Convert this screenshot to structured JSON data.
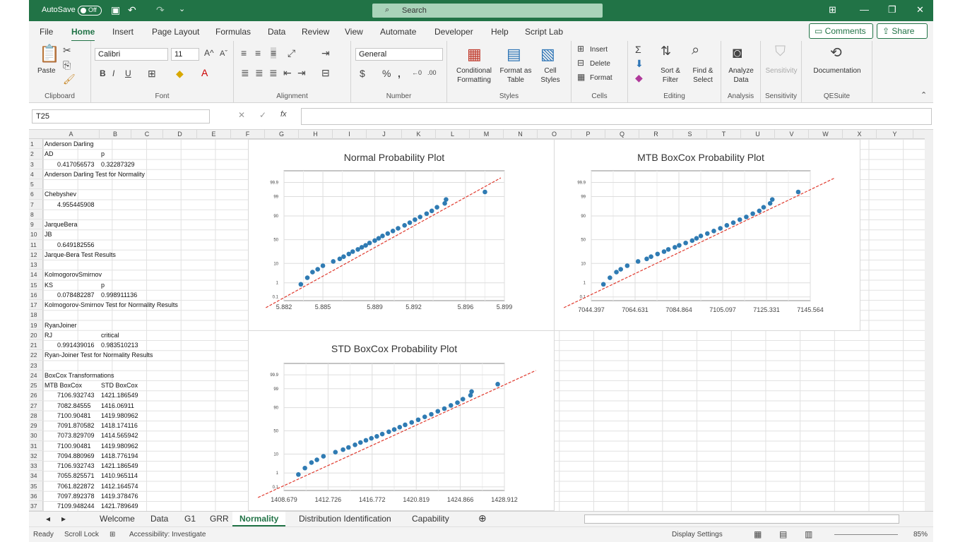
{
  "titlebar": {
    "autosave_label": "AutoSave",
    "autosave_state": "Off",
    "search_placeholder": "Search"
  },
  "menu": {
    "tabs": [
      "File",
      "Home",
      "Insert",
      "Page Layout",
      "Formulas",
      "Data",
      "Review",
      "View",
      "Automate",
      "Developer",
      "Help",
      "Script Lab"
    ],
    "active": "Home",
    "comments": "Comments",
    "share": "Share"
  },
  "ribbon": {
    "clipboard": {
      "paste": "Paste",
      "label": "Clipboard"
    },
    "font": {
      "name": "Calibri",
      "size": "11",
      "label": "Font"
    },
    "alignment": {
      "label": "Alignment"
    },
    "number": {
      "format": "General",
      "label": "Number"
    },
    "styles": {
      "conditional": "Conditional Formatting",
      "format_table": "Format as Table",
      "cell_styles": "Cell Styles",
      "label": "Styles"
    },
    "cells": {
      "insert": "Insert",
      "delete": "Delete",
      "format": "Format",
      "label": "Cells"
    },
    "editing": {
      "sort": "Sort & Filter",
      "find": "Find & Select",
      "label": "Editing"
    },
    "analysis": {
      "analyze": "Analyze Data",
      "label": "Analysis"
    },
    "sensitivity": {
      "btn": "Sensitivity",
      "label": "Sensitivity"
    },
    "qesuite": {
      "doc": "Documentation",
      "label": "QESuite"
    }
  },
  "formula_bar": {
    "name_box": "T25",
    "fx": "fx",
    "value": ""
  },
  "columns": [
    "A",
    "B",
    "C",
    "D",
    "E",
    "F",
    "G",
    "H",
    "I",
    "J",
    "K",
    "L",
    "M",
    "N",
    "O",
    "P",
    "Q",
    "R",
    "S",
    "T",
    "U",
    "V",
    "W",
    "X",
    "Y"
  ],
  "rows": [
    "1",
    "2",
    "3",
    "4",
    "5",
    "6",
    "7",
    "8",
    "9",
    "10",
    "11",
    "12",
    "13",
    "14",
    "15",
    "16",
    "17",
    "18",
    "19",
    "20",
    "21",
    "22",
    "23",
    "24",
    "25",
    "26",
    "27",
    "28",
    "29",
    "30",
    "31",
    "32",
    "33",
    "34",
    "35",
    "36",
    "37"
  ],
  "cells": {
    "r1a": "Anderson Darling",
    "r2a": "AD",
    "r2b": "p",
    "r3a": "0.417056573",
    "r3b": "0.32287329",
    "r4a": "Anderson Darling Test for Normality",
    "r6a": "Chebyshev",
    "r7a": "4.955445908",
    "r9a": "JarqueBera",
    "r10a": "JB",
    "r11a": "0.649182556",
    "r12a": "Jarque-Bera Test Results",
    "r14a": "KolmogorovSmirnov",
    "r15a": "KS",
    "r15b": "p",
    "r16a": "0.078482287",
    "r16b": "0.998911136",
    "r17a": "Kolmogorov-Smirnov Test for Normality Results",
    "r19a": "RyanJoiner",
    "r20a": "RJ",
    "r20b": "critical",
    "r21a": "0.991439016",
    "r21b": "0.983510213",
    "r22a": "Ryan-Joiner Test for Normality Results",
    "r24a": "BoxCox Transformations",
    "r25a": "MTB BoxCox",
    "r25b": "STD BoxCox",
    "r26a": "7106.932743",
    "r26b": "1421.186549",
    "r27a": "7082.84555",
    "r27b": "1416.06911",
    "r28a": "7100.90481",
    "r28b": "1419.980962",
    "r29a": "7091.870582",
    "r29b": "1418.174116",
    "r30a": "7073.829709",
    "r30b": "1414.565942",
    "r31a": "7100.90481",
    "r31b": "1419.980962",
    "r32a": "7094.880969",
    "r32b": "1418.776194",
    "r33a": "7106.932743",
    "r33b": "1421.186549",
    "r34a": "7055.825571",
    "r34b": "1410.965114",
    "r35a": "7061.822872",
    "r35b": "1412.164574",
    "r36a": "7097.892378",
    "r36b": "1419.378476",
    "r37a": "7109.948244",
    "r37b": "1421.789649"
  },
  "chart_data": [
    {
      "type": "scatter",
      "title": "Normal Probability Plot",
      "y_ticks": [
        "99.9",
        "99",
        "90",
        "50",
        "10",
        "1",
        "0.1"
      ],
      "x_ticks": [
        "5.882",
        "5.885",
        "5.889",
        "5.892",
        "5.896",
        "5.899"
      ],
      "fit_line": "red dashed",
      "points": [
        [
          5.8833,
          0.8
        ],
        [
          5.8838,
          2
        ],
        [
          5.8842,
          4
        ],
        [
          5.8846,
          5.5
        ],
        [
          5.885,
          8
        ],
        [
          5.8858,
          12
        ],
        [
          5.8863,
          15
        ],
        [
          5.8866,
          18
        ],
        [
          5.887,
          22
        ],
        [
          5.8873,
          26
        ],
        [
          5.8877,
          30
        ],
        [
          5.888,
          34
        ],
        [
          5.8883,
          38
        ],
        [
          5.8886,
          43
        ],
        [
          5.889,
          48
        ],
        [
          5.8893,
          53
        ],
        [
          5.8896,
          58
        ],
        [
          5.89,
          63
        ],
        [
          5.8904,
          68
        ],
        [
          5.8908,
          73
        ],
        [
          5.8913,
          78
        ],
        [
          5.8917,
          82
        ],
        [
          5.8921,
          86
        ],
        [
          5.8925,
          89
        ],
        [
          5.893,
          92
        ],
        [
          5.8934,
          94
        ],
        [
          5.8938,
          96
        ],
        [
          5.8944,
          97.5
        ],
        [
          5.8945,
          98.5
        ],
        [
          5.8975,
          99.5
        ]
      ]
    },
    {
      "type": "scatter",
      "title": "MTB BoxCox Probability Plot",
      "y_ticks": [
        "99.9",
        "99",
        "90",
        "50",
        "10",
        "1",
        "0.1"
      ],
      "x_ticks": [
        "7044.397",
        "7064.631",
        "7084.864",
        "7105.097",
        "7125.331",
        "7145.564"
      ],
      "fit_line": "red dashed",
      "points": [
        [
          7050,
          0.8
        ],
        [
          7053,
          2
        ],
        [
          7056,
          4
        ],
        [
          7058,
          5.5
        ],
        [
          7061,
          8
        ],
        [
          7066,
          12
        ],
        [
          7070,
          15
        ],
        [
          7072,
          18
        ],
        [
          7075,
          22
        ],
        [
          7078,
          26
        ],
        [
          7080,
          30
        ],
        [
          7083,
          34
        ],
        [
          7085,
          38
        ],
        [
          7088,
          43
        ],
        [
          7091,
          48
        ],
        [
          7093,
          53
        ],
        [
          7095,
          58
        ],
        [
          7098,
          63
        ],
        [
          7101,
          68
        ],
        [
          7104,
          73
        ],
        [
          7107,
          78
        ],
        [
          7110,
          82
        ],
        [
          7113,
          86
        ],
        [
          7116,
          89
        ],
        [
          7119,
          92
        ],
        [
          7122,
          94
        ],
        [
          7124,
          96
        ],
        [
          7127,
          97.5
        ],
        [
          7128,
          98.5
        ],
        [
          7140,
          99.5
        ]
      ]
    },
    {
      "type": "scatter",
      "title": "STD BoxCox Probability Plot",
      "y_ticks": [
        "99.9",
        "99",
        "90",
        "50",
        "10",
        "1",
        "0.1"
      ],
      "x_ticks": [
        "1408.679",
        "1412.726",
        "1416.772",
        "1420.819",
        "1424.866",
        "1428.912"
      ],
      "fit_line": "red dashed",
      "points": [
        [
          1410.0,
          0.8
        ],
        [
          1410.6,
          2
        ],
        [
          1411.2,
          4
        ],
        [
          1411.7,
          5.5
        ],
        [
          1412.3,
          8
        ],
        [
          1413.4,
          12
        ],
        [
          1414.1,
          15
        ],
        [
          1414.6,
          18
        ],
        [
          1415.2,
          22
        ],
        [
          1415.7,
          26
        ],
        [
          1416.2,
          30
        ],
        [
          1416.7,
          34
        ],
        [
          1417.2,
          38
        ],
        [
          1417.7,
          43
        ],
        [
          1418.3,
          48
        ],
        [
          1418.8,
          53
        ],
        [
          1419.3,
          58
        ],
        [
          1419.8,
          63
        ],
        [
          1420.4,
          68
        ],
        [
          1421.0,
          73
        ],
        [
          1421.6,
          78
        ],
        [
          1422.2,
          82
        ],
        [
          1422.8,
          86
        ],
        [
          1423.4,
          89
        ],
        [
          1424.0,
          92
        ],
        [
          1424.6,
          94
        ],
        [
          1425.1,
          96
        ],
        [
          1425.8,
          97.5
        ],
        [
          1425.9,
          98.5
        ],
        [
          1428.3,
          99.5
        ]
      ]
    }
  ],
  "sheet_tabs": [
    "Welcome",
    "Data",
    "G1",
    "GRR",
    "Normality",
    "Distribution Identification",
    "Capability"
  ],
  "active_sheet": "Normality",
  "status": {
    "ready": "Ready",
    "scroll_lock": "Scroll Lock",
    "accessibility": "Accessibility: Investigate",
    "display": "Display Settings",
    "zoom": "85%"
  }
}
